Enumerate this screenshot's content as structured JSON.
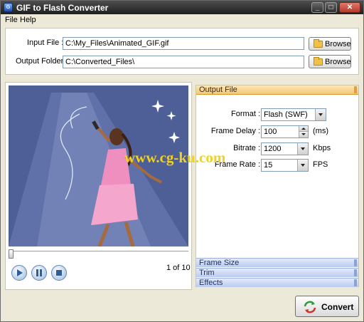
{
  "window": {
    "title": "GIF to Flash Converter",
    "app_icon": "gif-flash-app-icon"
  },
  "menu": {
    "items": [
      "File",
      "Help"
    ]
  },
  "form": {
    "input_label": "Input File :",
    "input_value": "C:\\My_Files\\Animated_GIF.gif",
    "output_label": "Output Folder :",
    "output_value": "C:\\Converted_Files\\",
    "browse_label": "Browse"
  },
  "preview": {
    "frame_counter": "1 of 10",
    "slider_position": 0,
    "controls": [
      "play-icon",
      "pause-icon",
      "stop-icon"
    ]
  },
  "settings": {
    "sections": {
      "output_file": "Output File",
      "frame_size": "Frame Size",
      "trim": "Trim",
      "effects": "Effects"
    },
    "format_label": "Format :",
    "format_value": "Flash (SWF)",
    "delay_label": "Frame Delay :",
    "delay_value": "100",
    "delay_unit": "(ms)",
    "bitrate_label": "Bitrate :",
    "bitrate_value": "1200",
    "bitrate_unit": "Kbps",
    "fps_label": "Frame Rate :",
    "fps_value": "15",
    "fps_unit": "FPS"
  },
  "convert_label": "Convert",
  "watermark": "www.cg-ku.com",
  "colors": {
    "accent_active_section": "#f3c878",
    "section_header": "#b9cbf0",
    "preview_bg": "#4d5f96",
    "watermark": "#f3d21a"
  }
}
